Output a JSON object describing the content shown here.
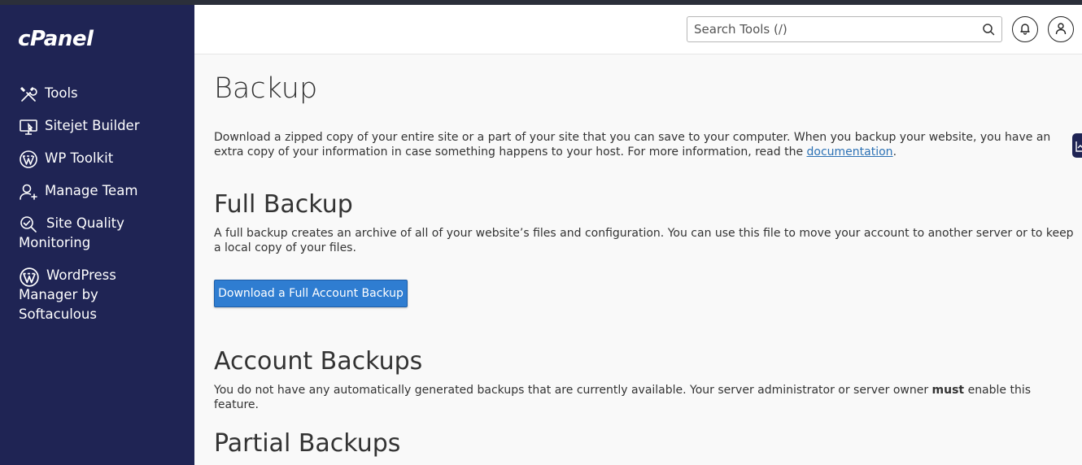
{
  "sidebar": {
    "logo": "cPanel",
    "items": [
      {
        "label": "Tools",
        "icon": "tools-icon"
      },
      {
        "label": "Sitejet Builder",
        "icon": "monitor-icon"
      },
      {
        "label": "WP Toolkit",
        "icon": "wordpress-icon"
      },
      {
        "label": "Manage Team",
        "icon": "user-plus-icon"
      },
      {
        "label": "Site Quality Monitoring",
        "icon": "magnifier-icon"
      },
      {
        "label": "WordPress Manager by Softaculous",
        "icon": "wordpress-icon"
      }
    ]
  },
  "header": {
    "search_placeholder": "Search Tools (/)"
  },
  "main": {
    "title": "Backup",
    "intro_before": "Download a zipped copy of your entire site or a part of your site that you can save to your computer. When you backup your website, you have an extra copy of your information in case something happens to your host. For more information, read the ",
    "intro_link": "documentation",
    "intro_after": ".",
    "full_backup": {
      "heading": "Full Backup",
      "text": "A full backup creates an archive of all of your website’s files and configuration. You can use this file to move your account to another server or to keep a local copy of your files.",
      "button": "Download a Full Account Backup"
    },
    "account_backups": {
      "heading": "Account Backups",
      "text_before": "You do not have any automatically generated backups that are currently available. Your server administrator or server owner ",
      "text_bold": "must",
      "text_after": " enable this feature."
    },
    "partial_backups": {
      "heading": "Partial Backups"
    }
  },
  "colors": {
    "sidebar_bg": "#1f2454",
    "primary_button": "#2f7dd1",
    "link": "#2d72b5"
  }
}
